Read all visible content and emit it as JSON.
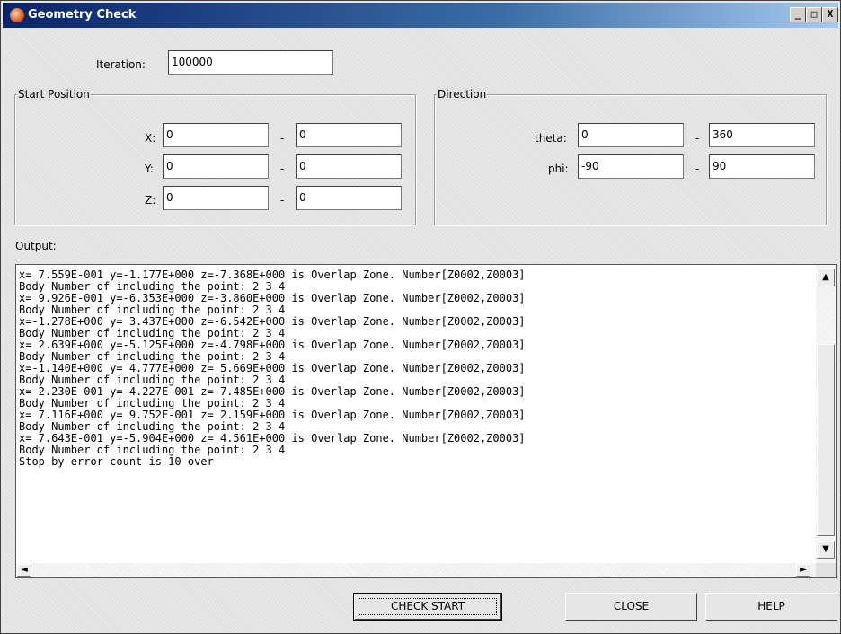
{
  "window": {
    "title": "Geometry Check",
    "controls": {
      "minimize": "_",
      "maximize": "□",
      "close": "X"
    }
  },
  "iteration": {
    "label": "Iteration:",
    "value": "100000"
  },
  "start_position": {
    "legend": "Start Position",
    "x": {
      "label": "X:",
      "from": "0",
      "dash": "-",
      "to": "0"
    },
    "y": {
      "label": "Y:",
      "from": "0",
      "dash": "-",
      "to": "0"
    },
    "z": {
      "label": "Z:",
      "from": "0",
      "dash": "-",
      "to": "0"
    }
  },
  "direction": {
    "legend": "Direction",
    "theta": {
      "label": "theta:",
      "from": "0",
      "dash": "-",
      "to": "360"
    },
    "phi": {
      "label": "phi:",
      "from": "-90",
      "dash": "-",
      "to": "90"
    }
  },
  "output": {
    "label": "Output:",
    "lines": [
      "x= 7.559E-001 y=-1.177E+000 z=-7.368E+000 is Overlap Zone. Number[Z0002,Z0003]",
      "Body Number of including the point: 2 3 4",
      "x= 9.926E-001 y=-6.353E+000 z=-3.860E+000 is Overlap Zone. Number[Z0002,Z0003]",
      "Body Number of including the point: 2 3 4",
      "x=-1.278E+000 y= 3.437E+000 z=-6.542E+000 is Overlap Zone. Number[Z0002,Z0003]",
      "Body Number of including the point: 2 3 4",
      "x= 2.639E+000 y=-5.125E+000 z=-4.798E+000 is Overlap Zone. Number[Z0002,Z0003]",
      "Body Number of including the point: 2 3 4",
      "x=-1.140E+000 y= 4.777E+000 z= 5.669E+000 is Overlap Zone. Number[Z0002,Z0003]",
      "Body Number of including the point: 2 3 4",
      "x= 2.230E-001 y=-4.227E-001 z=-7.485E+000 is Overlap Zone. Number[Z0002,Z0003]",
      "Body Number of including the point: 2 3 4",
      "x= 7.116E+000 y= 9.752E-001 z= 2.159E+000 is Overlap Zone. Number[Z0002,Z0003]",
      "Body Number of including the point: 2 3 4",
      "x= 7.643E-001 y=-5.904E+000 z= 4.561E+000 is Overlap Zone. Number[Z0002,Z0003]",
      "Body Number of including the point: 2 3 4",
      "Stop by error count is 10 over"
    ],
    "scroll": {
      "up": "▲",
      "down": "▼",
      "left": "◄",
      "right": "►"
    }
  },
  "buttons": {
    "check_start": "CHECK START",
    "close": "CLOSE",
    "help": "HELP"
  }
}
